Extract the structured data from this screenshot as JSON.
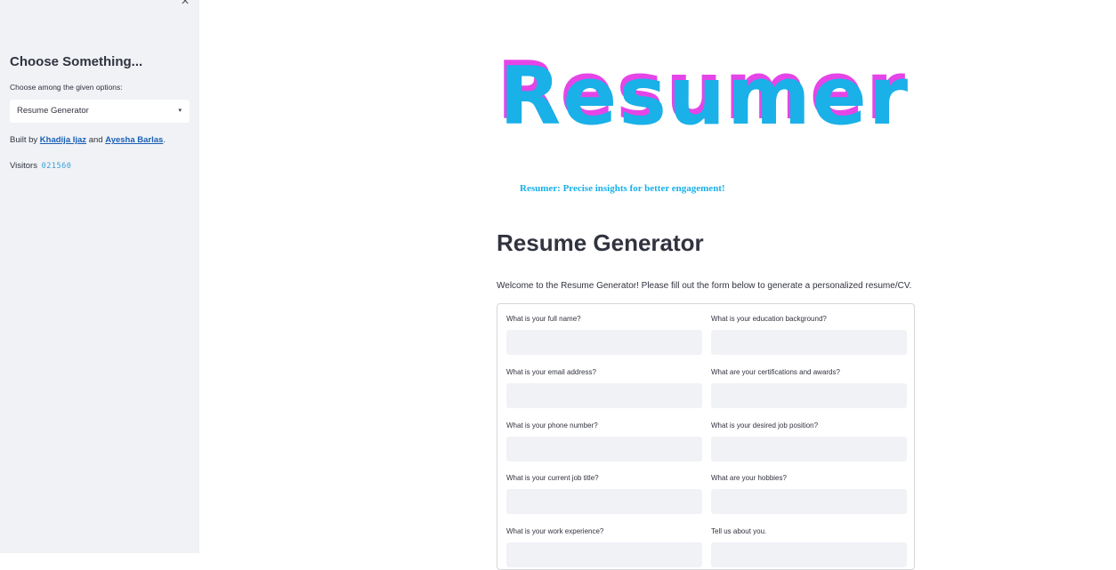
{
  "sidebar": {
    "close_icon": "×",
    "title": "Choose Something...",
    "select_label": "Choose among the given options:",
    "select_value": "Resume Generator",
    "caret_icon": "▾",
    "built_prefix": "Built by ",
    "author1": "Khadija Ijaz",
    "built_and": " and ",
    "author2": "Ayesha Barlas",
    "built_suffix": ".",
    "visitors_label": "Visitors",
    "visitors_count": "021560"
  },
  "main": {
    "logo_text": "Resumer",
    "tagline": "Resumer: Precise insights for better engagement!",
    "heading": "Resume Generator",
    "intro": "Welcome to the Resume Generator! Please fill out the form below to generate a personalized resume/CV.",
    "form": {
      "left_fields": [
        {
          "label": "What is your full name?",
          "value": ""
        },
        {
          "label": "What is your email address?",
          "value": ""
        },
        {
          "label": "What is your phone number?",
          "value": ""
        },
        {
          "label": "What is your current job title?",
          "value": ""
        },
        {
          "label": "What is your work experience?",
          "value": ""
        }
      ],
      "right_fields": [
        {
          "label": "What is your education background?",
          "value": ""
        },
        {
          "label": "What are your certifications and awards?",
          "value": ""
        },
        {
          "label": "What is your desired job position?",
          "value": ""
        },
        {
          "label": "What are your hobbies?",
          "value": ""
        },
        {
          "label": "Tell us about you.",
          "value": ""
        }
      ]
    }
  },
  "colors": {
    "sidebar_bg": "#f0f2f6",
    "logo_cyan": "#1ab0e8",
    "logo_magenta": "#e545e8",
    "link": "#1a5fb4",
    "input_bg": "#f0f2f6"
  }
}
